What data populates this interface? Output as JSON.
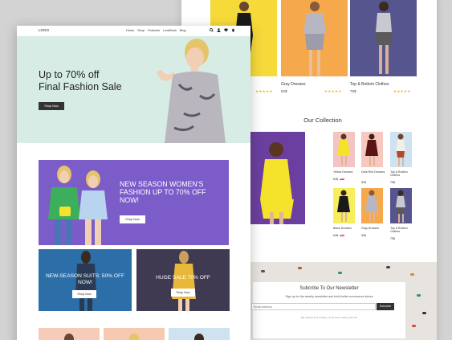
{
  "back_page": {
    "products_top": [
      {
        "name": "",
        "price": ""
      },
      {
        "name": "Gray Dresses",
        "price": "52$"
      },
      {
        "name": "Top & Bottom Clothes",
        "price": "75$"
      }
    ],
    "star_rating": "★★★★★",
    "collection_title": "Our Collection",
    "collection_items": [
      {
        "name": "Yellow Dresses",
        "price": "64$",
        "old_price": "45$"
      },
      {
        "name": "Dark Red Dresses",
        "price": "52$"
      },
      {
        "name": "Top & Bottom Clothes",
        "price": "75$"
      },
      {
        "name": "Black Dresses",
        "price": "64$",
        "old_price": "45$"
      },
      {
        "name": "Gray Dresses",
        "price": "52$"
      },
      {
        "name": "Top & Bottom Clothes",
        "price": "75$"
      }
    ],
    "newsletter": {
      "title": "Subcribe To Our Newsletter",
      "subtitle": "Sign up for the weekly newsletter and build better ecommerce stores",
      "email_placeholder": "Email Address",
      "button_label": "Subcribe",
      "footnote": "We respect your privacy, so we never share your info"
    }
  },
  "front_page": {
    "nav": {
      "logo": "LOGO",
      "links": [
        "Home",
        "Shop",
        "Features",
        "LookBook",
        "Blog"
      ]
    },
    "hero": {
      "title_line1": "Up to 70% off",
      "title_line2": "Final Fashion Sale",
      "button_label": "Shop Now"
    },
    "promo": {
      "title": "NEW SEASON WOMEN'S FASHION UP TO 70% OFF NOW!",
      "button_label": "Shop Now"
    },
    "tiles": [
      {
        "title": "NEW-SEASON SUITS: 50% OFF NOW!",
        "button_label": "Shop Now"
      },
      {
        "title": "HUGE SALE 70% OFF",
        "button_label": "Shop Now"
      }
    ]
  },
  "colors": {
    "hero_bg": "#d6ece5",
    "promo_bg": "#7b5cc9",
    "tile1_bg": "#2b6ea8",
    "tile2_bg": "#3f3a52",
    "collection_bg": "#6b3fa0",
    "button_dark": "#333333",
    "sale_price": "#e23b3b",
    "stars": "#f0b400"
  }
}
